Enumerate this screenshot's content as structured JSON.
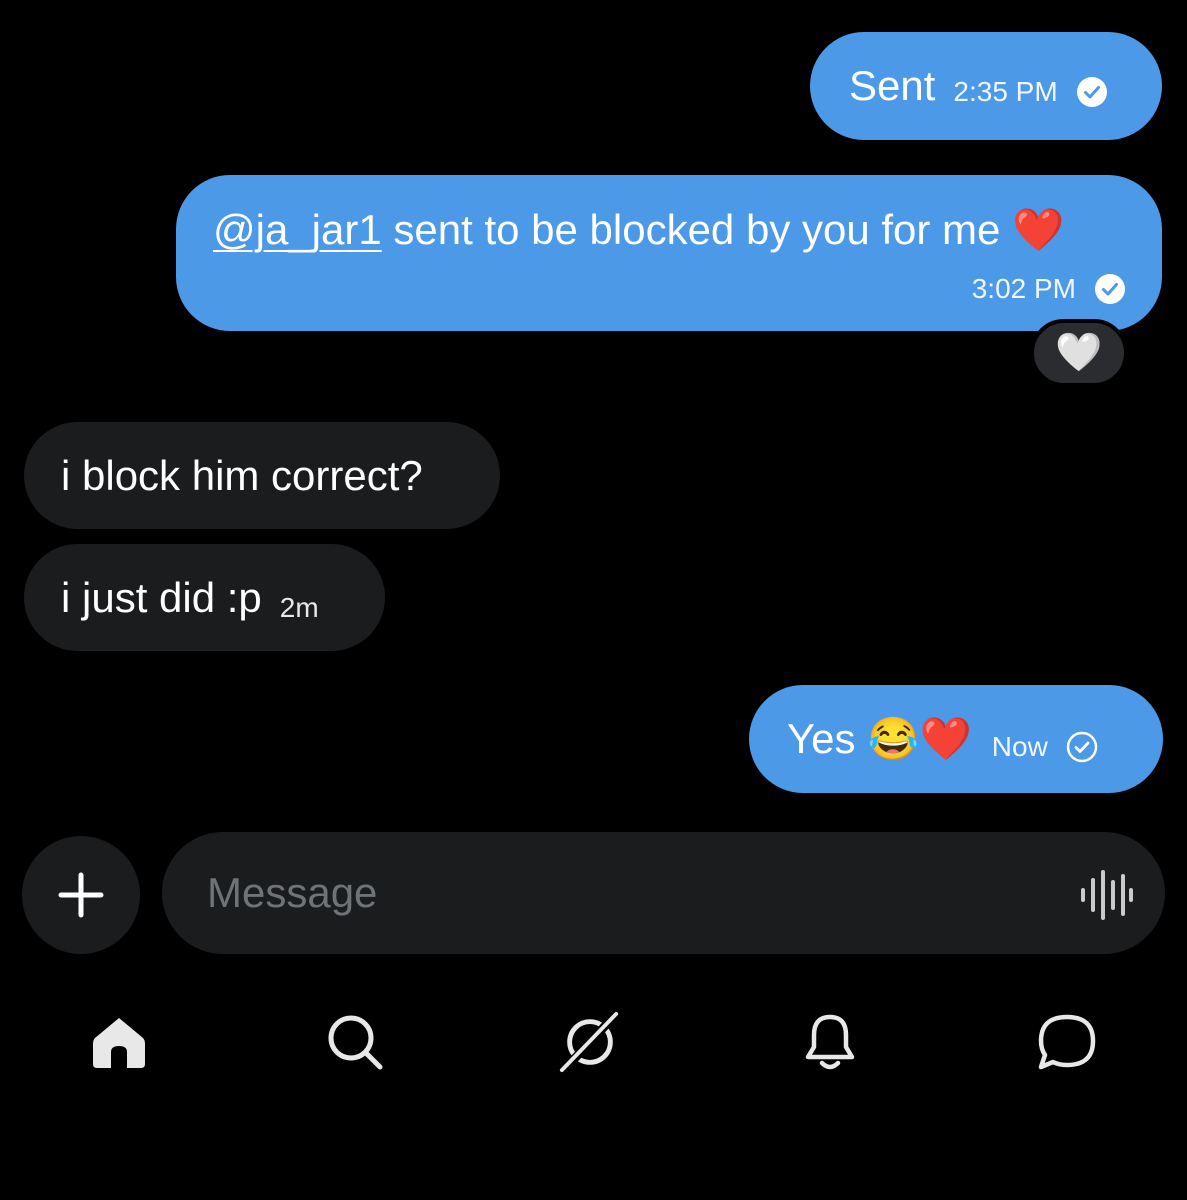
{
  "messages": [
    {
      "text": "Sent",
      "time": "2:35 PM"
    },
    {
      "mention": "@ja_jar1",
      "text": " sent to be blocked by you for me ❤️",
      "time": "3:02 PM",
      "reaction": "🤍"
    },
    {
      "text": "i block him correct?"
    },
    {
      "text": "i just did :p",
      "time": "2m"
    },
    {
      "text": "Yes 😂❤️",
      "time": "Now"
    }
  ],
  "composer": {
    "placeholder": "Message"
  },
  "nav": {
    "items": [
      {
        "icon": "home-icon"
      },
      {
        "icon": "search-icon"
      },
      {
        "icon": "grok-icon"
      },
      {
        "icon": "bell-icon"
      },
      {
        "icon": "messages-icon"
      }
    ]
  },
  "colors": {
    "background": "#000000",
    "outgoing": "#4c99e8",
    "incoming": "#1b1c1e",
    "placeholder": "#6e7378"
  }
}
